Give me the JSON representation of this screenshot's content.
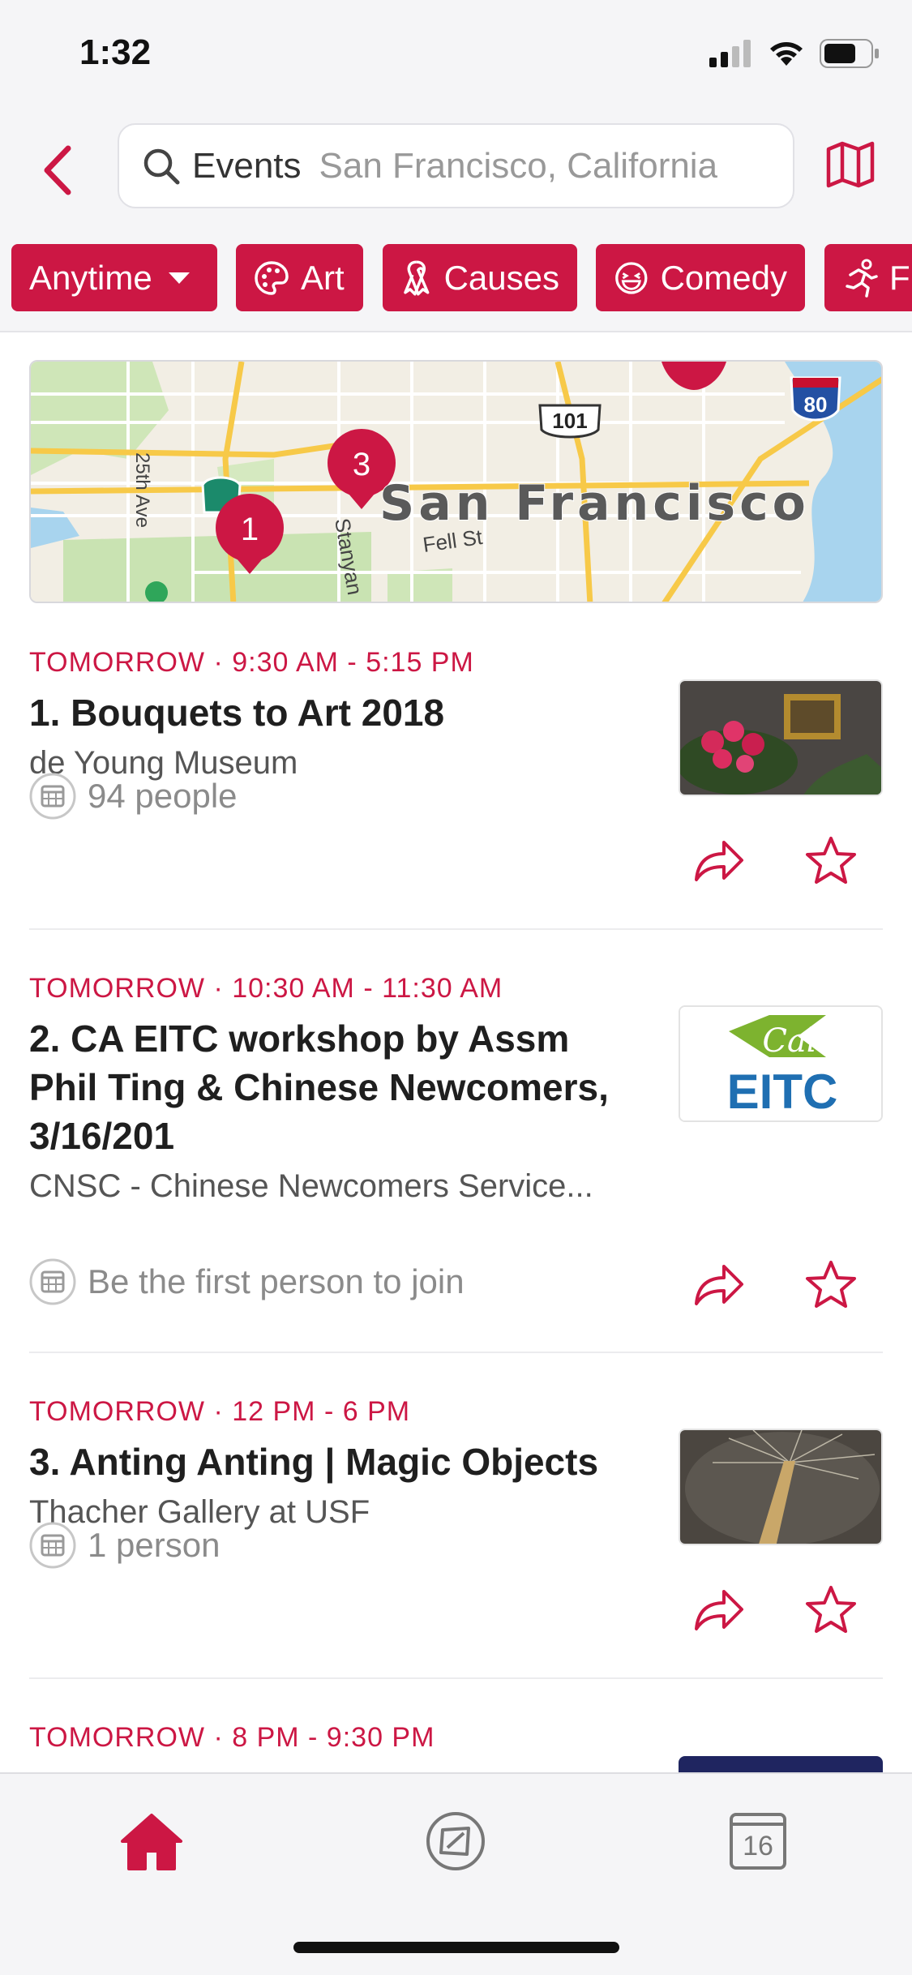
{
  "status": {
    "time": "1:32"
  },
  "search": {
    "query": "Events",
    "location": "San Francisco, California"
  },
  "filters": [
    {
      "label": "Anytime",
      "icon": "chevron-down-icon"
    },
    {
      "label": "Art",
      "icon": "palette-icon"
    },
    {
      "label": "Causes",
      "icon": "ribbon-icon"
    },
    {
      "label": "Comedy",
      "icon": "laughing-face-icon"
    },
    {
      "label": "Fi",
      "icon": "runner-icon"
    }
  ],
  "map": {
    "city_label": "San Francisco",
    "road_labels": [
      "25th Ave",
      "Stanyan",
      "Fell St"
    ],
    "highway_shields": [
      "101",
      "80",
      "1"
    ],
    "pins": [
      "1",
      "3"
    ]
  },
  "events": [
    {
      "when": "TOMORROW · 9:30 AM - 5:15 PM",
      "title": "1. Bouquets to Art 2018",
      "venue": "de Young Museum",
      "people": "94 people"
    },
    {
      "when": "TOMORROW · 10:30 AM - 11:30 AM",
      "title": "2. CA EITC workshop by Assm Phil Ting & Chinese Newcomers, 3/16/201",
      "venue": "CNSC - Chinese Newcomers Service...",
      "people": "Be the first person to join",
      "thumb_text_top": "Cal",
      "thumb_text_bottom": "EITC"
    },
    {
      "when": "TOMORROW · 12 PM - 6 PM",
      "title": "3. Anting Anting | Magic Objects",
      "venue": "Thacher Gallery at USF",
      "people": "1 person"
    },
    {
      "when": "TOMORROW · 8 PM - 9:30 PM"
    }
  ],
  "tabs": {
    "calendar_day": "16"
  },
  "colors": {
    "accent": "#cc1744",
    "background": "#f5f5f7"
  }
}
